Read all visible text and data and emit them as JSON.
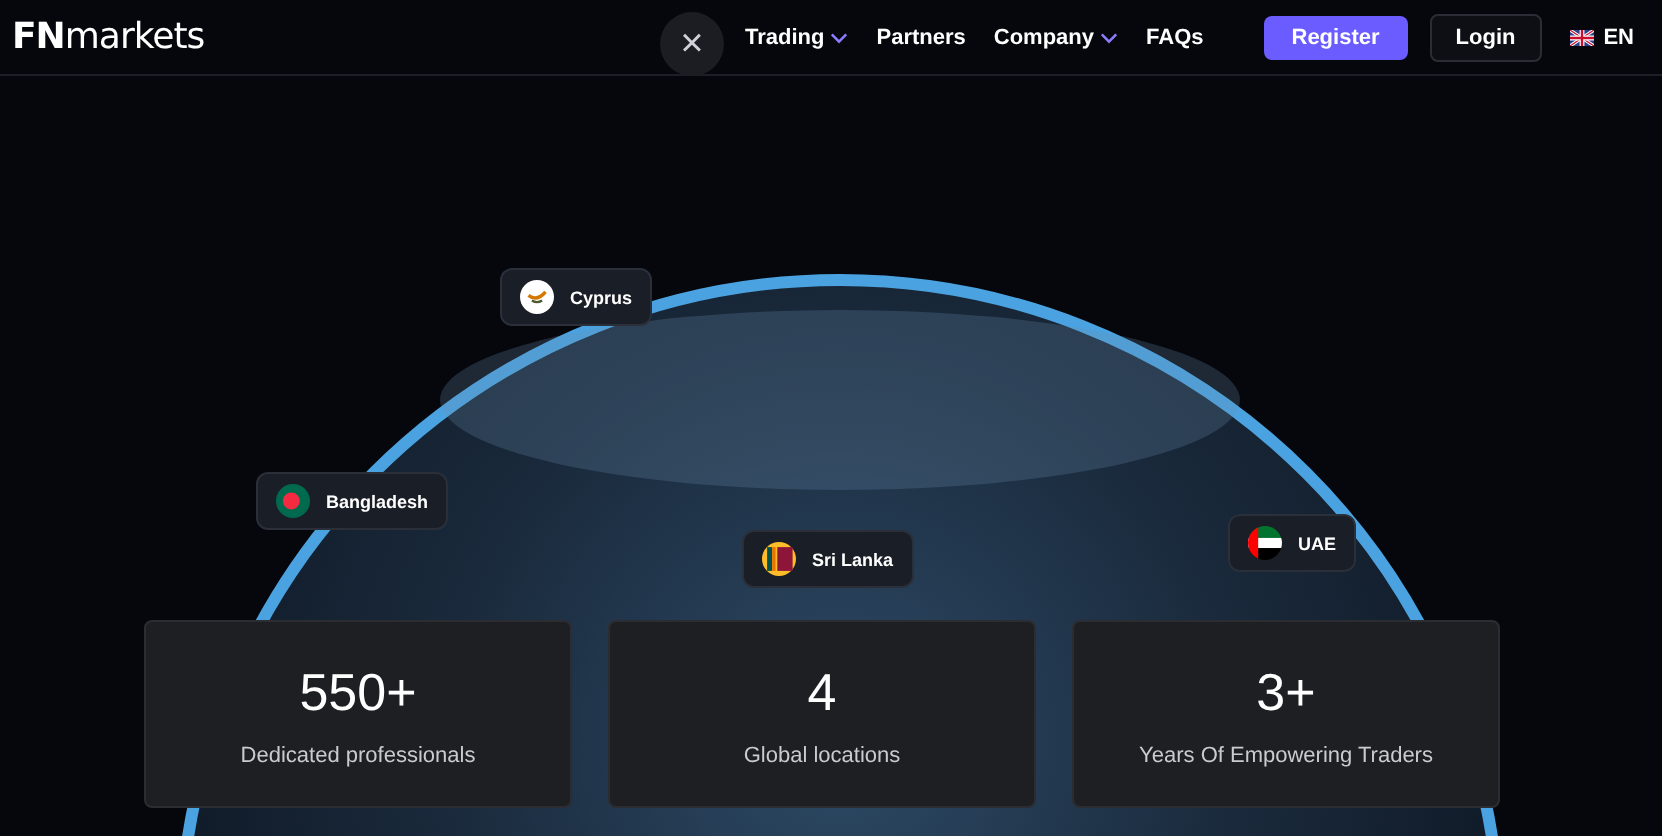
{
  "header": {
    "logo": {
      "bold": "FN",
      "light": "markets"
    },
    "nav": [
      {
        "label": "Trading",
        "dropdown": true
      },
      {
        "label": "Partners",
        "dropdown": false
      },
      {
        "label": "Company",
        "dropdown": true
      },
      {
        "label": "FAQs",
        "dropdown": false
      }
    ],
    "register": "Register",
    "login": "Login",
    "language": "EN"
  },
  "close_button": "×",
  "locations": [
    {
      "name": "Cyprus",
      "kind": "cyprus"
    },
    {
      "name": "Bangladesh",
      "kind": "bangladesh"
    },
    {
      "name": "Sri Lanka",
      "kind": "srilanka"
    },
    {
      "name": "UAE",
      "kind": "uae"
    }
  ],
  "stats": [
    {
      "value": "550+",
      "label": "Dedicated professionals"
    },
    {
      "value": "4",
      "label": "Global locations"
    },
    {
      "value": "3+",
      "label": "Years Of Empowering Traders"
    }
  ]
}
